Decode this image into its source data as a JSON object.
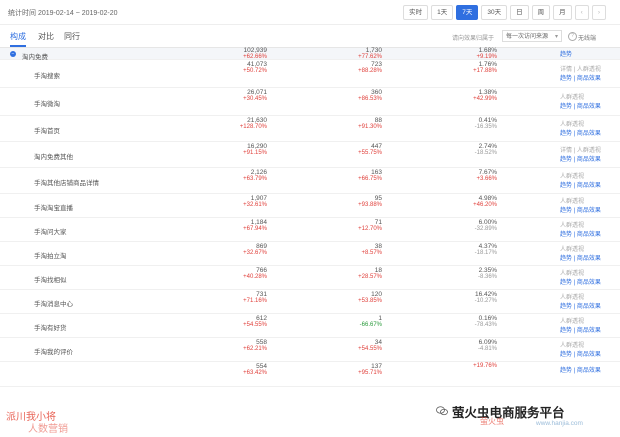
{
  "header": {
    "stat_period": "统计时间 2019-02-14 ~ 2019-02-20",
    "time_buttons": [
      "实时",
      "1天",
      "7天",
      "30天",
      "日",
      "周",
      "月"
    ],
    "active_time": "7天",
    "prev_icon": "chevron-left-icon",
    "next_icon": "chevron-right-icon"
  },
  "tabs": {
    "items": [
      "构成",
      "对比",
      "同行"
    ],
    "active": "构成"
  },
  "filters": {
    "label": "请向效果归属于",
    "select_value": "每一次访问来源",
    "nodup_label": "无线端"
  },
  "colors": {
    "accent": "#2f6fe0",
    "up": "#e0403b",
    "down": "#2a9a3b"
  },
  "rows": [
    {
      "name": "淘内免费",
      "v1": "102,939",
      "p1": "+62.66%",
      "v2": "1,730",
      "p2": "+77.62%",
      "v3": "1.68%",
      "p3": "+9.19%",
      "a1": "",
      "a2": "趋势",
      "root": true
    },
    {
      "name": "手淘搜索",
      "v1": "41,073",
      "p1": "+50.72%",
      "v2": "723",
      "p2": "+88.28%",
      "v3": "1.76%",
      "p3": "+17.88%",
      "a1": "详情 | 人群透视",
      "a2": "趋势 | 商品效果"
    },
    {
      "name": "手淘微淘",
      "v1": "26,071",
      "p1": "+30.45%",
      "v2": "360",
      "p2": "+86.53%",
      "v3": "1.38%",
      "p3": "+42.99%",
      "a1": "人群透视",
      "a2": "趋势 | 商品效果"
    },
    {
      "name": "手淘首页",
      "v1": "21,630",
      "p1": "+128.70%",
      "v2": "88",
      "p2": "+91.30%",
      "v3": "0.41%",
      "p3": "-16.35%",
      "a1": "人群透视",
      "a2": "趋势 | 商品效果"
    },
    {
      "name": "淘内免费其他",
      "v1": "16,290",
      "p1": "+91.15%",
      "v2": "447",
      "p2": "+55.75%",
      "v3": "2.74%",
      "p3": "-18.52%",
      "a1": "详情 | 人群透视",
      "a2": "趋势 | 商品效果"
    },
    {
      "name": "手淘其他店铺商品详情",
      "v1": "2,126",
      "p1": "+63.79%",
      "v2": "163",
      "p2": "+66.75%",
      "v3": "7.67%",
      "p3": "+3.66%",
      "a1": "人群透视",
      "a2": "趋势 | 商品效果"
    },
    {
      "name": "手淘淘宝直播",
      "v1": "1,907",
      "p1": "+32.61%",
      "v2": "95",
      "p2": "+93.88%",
      "v3": "4.98%",
      "p3": "+46.20%",
      "a1": "人群透视",
      "a2": "趋势 | 商品效果"
    },
    {
      "name": "手淘问大家",
      "v1": "1,184",
      "p1": "+67.94%",
      "v2": "71",
      "p2": "+12.70%",
      "v3": "6.00%",
      "p3": "-32.89%",
      "a1": "人群透视",
      "a2": "趋势 | 商品效果"
    },
    {
      "name": "手淘拍立淘",
      "v1": "869",
      "p1": "+32.67%",
      "v2": "38",
      "p2": "+8.57%",
      "v3": "4.37%",
      "p3": "-18.17%",
      "a1": "人群透视",
      "a2": "趋势 | 商品效果"
    },
    {
      "name": "手淘找相似",
      "v1": "766",
      "p1": "+40.28%",
      "v2": "18",
      "p2": "+28.57%",
      "v3": "2.35%",
      "p3": "-8.36%",
      "a1": "人群透视",
      "a2": "趋势 | 商品效果"
    },
    {
      "name": "手淘消息中心",
      "v1": "731",
      "p1": "+71.16%",
      "v2": "120",
      "p2": "+53.85%",
      "v3": "16.42%",
      "p3": "-10.27%",
      "a1": "人群透视",
      "a2": "趋势 | 商品效果"
    },
    {
      "name": "手淘有好货",
      "v1": "612",
      "p1": "+54.55%",
      "v2": "1",
      "p2": "-66.67%",
      "v3": "0.16%",
      "p3": "-78.43%",
      "a1": "人群透视",
      "a2": "趋势 | 商品效果"
    },
    {
      "name": "手淘我的评价",
      "v1": "558",
      "v1x": "",
      "p1": "+62.21%",
      "v2": "34",
      "p2": "+54.55%",
      "v3": "6.09%",
      "p3": "-4.81%",
      "a1": "人群透视",
      "a2": "趋势 | 商品效果"
    },
    {
      "name": "",
      "v1": "554",
      "p1": "+63.42%",
      "v2": "137",
      "p2": "+95.71%",
      "v3": "",
      "p3": "+19.76%",
      "a1": "",
      "a2": "趋势 | 商品效果"
    }
  ],
  "watermark": {
    "left_line1": "派川我小将",
    "left_line2": "人数营销",
    "right_title": "萤火虫电商服务平台",
    "right_url": "www.hanjia.com",
    "logo_text": "萤火虫",
    "wechat_icon": "wechat-icon"
  }
}
